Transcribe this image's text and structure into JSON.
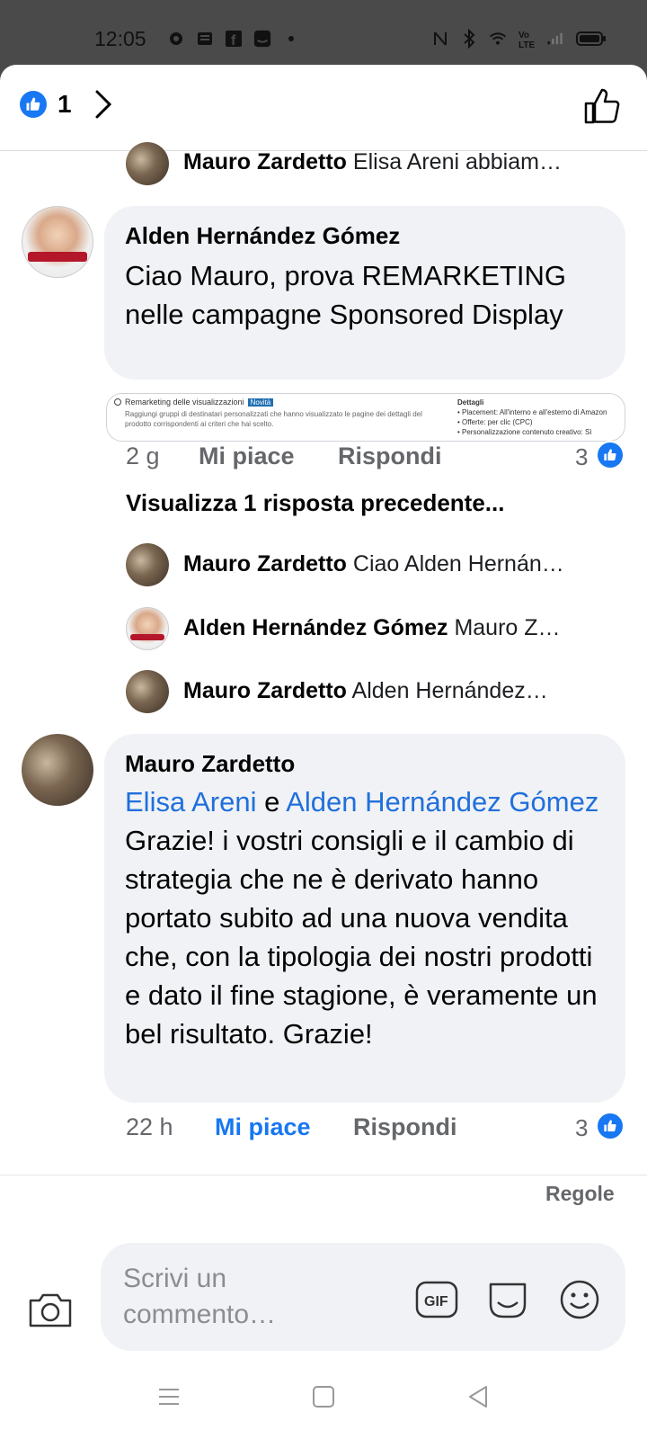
{
  "status_bar": {
    "time": "12:05",
    "left_icons": [
      "gear-icon",
      "news-icon",
      "facebook-icon",
      "amazon-icon",
      "dot-icon"
    ],
    "right_icons": [
      "nfc-icon",
      "bluetooth-icon",
      "wifi-icon",
      "volte-icon",
      "signal-icon",
      "battery-icon"
    ]
  },
  "header": {
    "reaction_count": "1"
  },
  "thread": {
    "top_reply": {
      "name": "Mauro Zardetto",
      "snippet": "Elisa Areni abbiam…"
    },
    "comment1": {
      "author": "Alden Hernández Gómez",
      "text": "Ciao Mauro, prova REMARKETING nelle campagne Sponsored Display",
      "attachment": {
        "title": "Remarketing delle visualizzazioni",
        "badge": "Novità",
        "body": "Raggiungi gruppi di destinatari personalizzati che hanno visualizzato le pagine dei dettagli del prodotto corrispondenti ai criteri che hai scelto.",
        "right_title": "Dettagli",
        "right_items": [
          "• Placement: All'interno e all'esterno di Amazon",
          "• Offerte: per clic (CPC)",
          "• Personalizzazione contenuto creativo: Sì"
        ]
      },
      "time": "2 g",
      "like_label": "Mi piace",
      "reply_label": "Rispondi",
      "reaction_count": "3"
    },
    "view_previous": "Visualizza 1 risposta precedente...",
    "replies": [
      {
        "name": "Mauro Zardetto",
        "snippet": "Ciao Alden Hernán…"
      },
      {
        "name": "Alden Hernández Gómez",
        "snippet": "Mauro Z…"
      },
      {
        "name": "Mauro Zardetto",
        "snippet": "Alden Hernández…"
      }
    ],
    "comment2": {
      "author": "Mauro Zardetto",
      "mention1": "Elisa Areni",
      "connector": " e ",
      "mention2": "Alden Hernández Gómez",
      "text": " Grazie! i vostri consigli e il cambio di strategia che ne è derivato hanno portato subito ad una nuova vendita che, con la tipologia dei nostri prodotti e dato il fine stagione, è veramente un bel risultato. Grazie!",
      "time": "22 h",
      "like_label": "Mi piace",
      "reply_label": "Rispondi",
      "reaction_count": "3"
    }
  },
  "footer": {
    "rules_label": "Regole",
    "composer_placeholder": "Scrivi un commento…",
    "gif_label": "GIF"
  },
  "colors": {
    "accent": "#1877f2",
    "mention": "#216fdb",
    "bubble": "#f0f2f5",
    "muted": "#65676b"
  }
}
